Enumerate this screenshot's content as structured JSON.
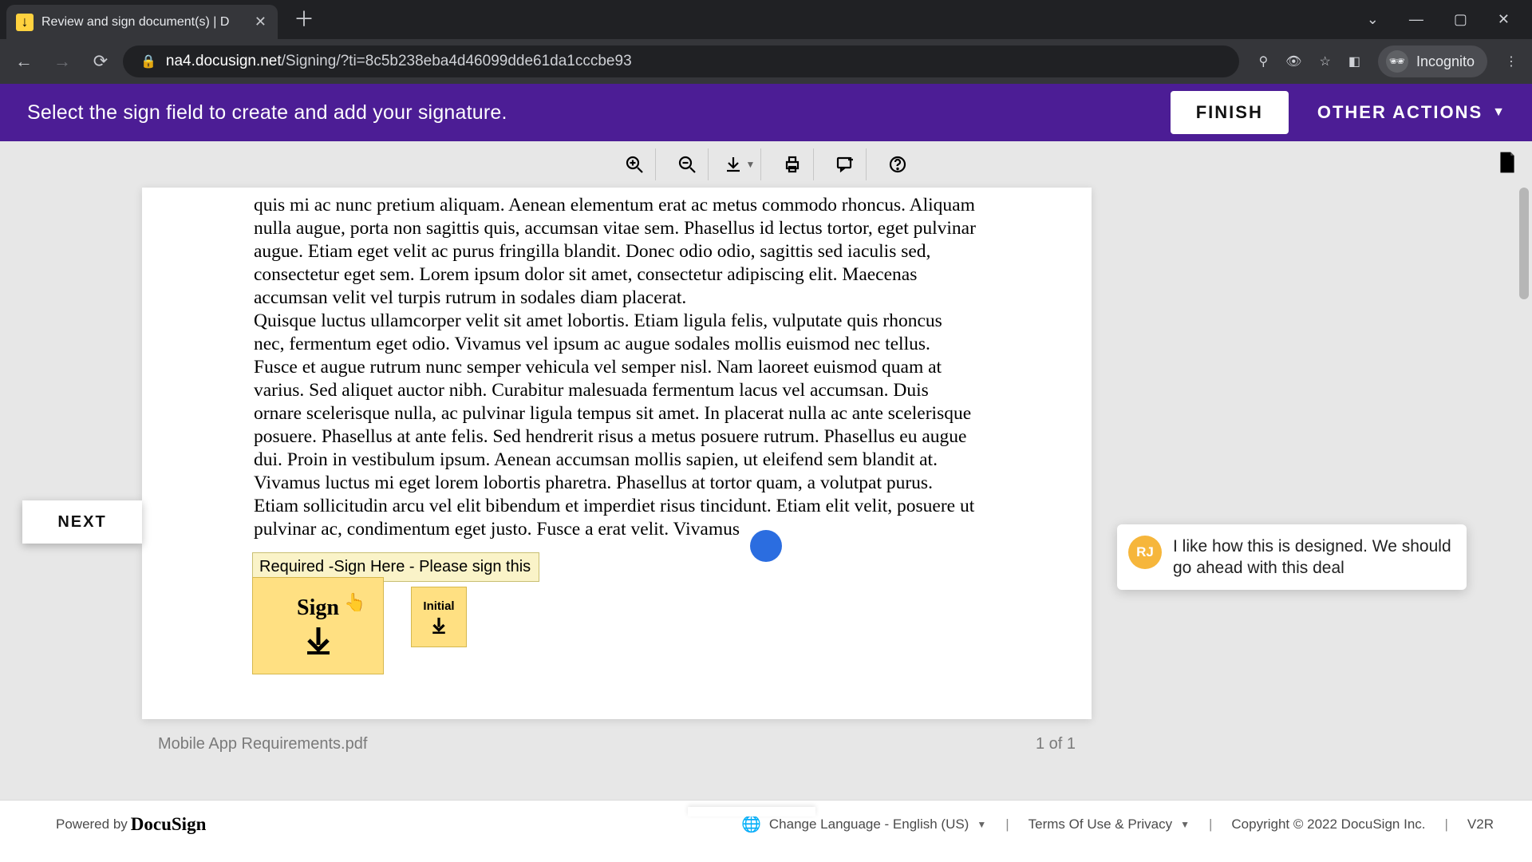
{
  "browser": {
    "tab_title": "Review and sign document(s) | D",
    "url_host": "na4.docusign.net",
    "url_path": "/Signing/?ti=8c5b238eba4d46099dde61da1cccbe93",
    "incognito_label": "Incognito"
  },
  "action_bar": {
    "prompt": "Select the sign field to create and add your signature.",
    "finish": "FINISH",
    "other_actions": "OTHER ACTIONS"
  },
  "toolbar": {
    "zoom_in": "zoom-in",
    "zoom_out": "zoom-out",
    "download": "download",
    "print": "print",
    "comment": "comment",
    "help": "help"
  },
  "document": {
    "body_text": "quis mi ac nunc pretium aliquam. Aenean elementum erat ac metus commodo rhoncus. Aliquam nulla augue, porta non sagittis quis, accumsan vitae sem. Phasellus id lectus tortor, eget pulvinar augue. Etiam eget velit ac purus fringilla blandit. Donec odio odio, sagittis sed iaculis sed, consectetur eget sem. Lorem ipsum dolor sit amet, consectetur adipiscing elit. Maecenas accumsan velit vel turpis rutrum in sodales diam placerat.\nQuisque luctus ullamcorper velit sit amet lobortis. Etiam ligula felis, vulputate quis rhoncus nec, fermentum eget odio. Vivamus vel ipsum ac augue sodales mollis euismod nec tellus. Fusce et augue rutrum nunc semper vehicula vel semper nisl. Nam laoreet euismod quam at varius. Sed aliquet auctor nibh. Curabitur malesuada fermentum lacus vel accumsan. Duis ornare scelerisque nulla, ac pulvinar ligula tempus sit amet. In placerat nulla ac ante scelerisque posuere. Phasellus at ante felis. Sed hendrerit risus a metus posuere rutrum. Phasellus eu augue dui. Proin in vestibulum ipsum. Aenean accumsan mollis sapien, ut eleifend sem blandit at. Vivamus luctus mi eget lorem lobortis pharetra. Phasellus at tortor quam, a volutpat purus. Etiam sollicitudin arcu vel elit bibendum et imperdiet risus tincidunt. Etiam elit velit, posuere ut pulvinar ac, condimentum eget justo. Fusce a erat velit. Vivamus",
    "sign_tooltip": "Required -Sign Here - Please sign this",
    "sign_label": "Sign",
    "initial_label": "Initial",
    "filename": "Mobile App Requirements.pdf",
    "page_indicator": "1 of 1"
  },
  "next_label": "NEXT",
  "comment": {
    "avatar_initials": "RJ",
    "text": "I like how this is designed. We should go ahead with this deal"
  },
  "footer": {
    "powered_by": "Powered by",
    "brand": "DocuSign",
    "language": "Change Language - English (US)",
    "terms": "Terms Of Use & Privacy",
    "copyright": "Copyright © 2022 DocuSign Inc.",
    "version": "V2R"
  },
  "colors": {
    "purple": "#4c1d95",
    "sign_yellow": "#ffe082",
    "comment_avatar": "#f6b63b",
    "blue_dot": "#2b6de0"
  }
}
